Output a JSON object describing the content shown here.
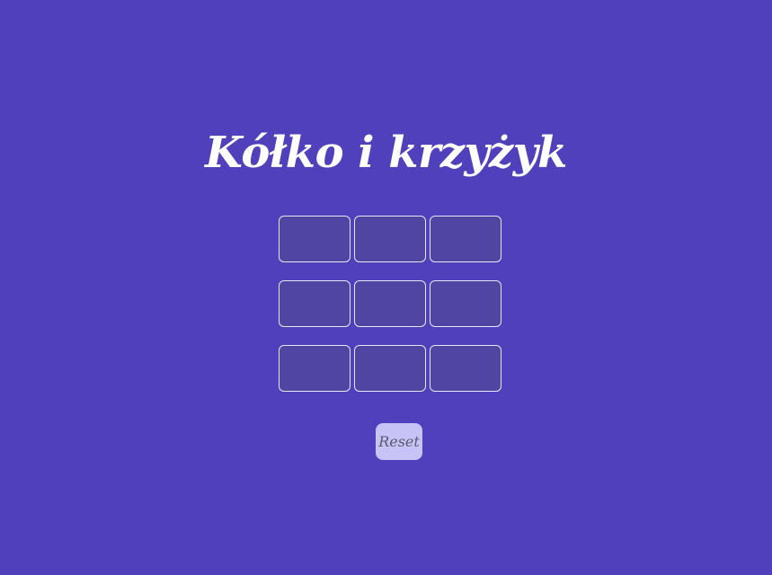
{
  "page": {
    "title": "Kółko i krzyżyk",
    "background_color": "#5040bc"
  },
  "board": {
    "rows": [
      [
        "",
        "",
        ""
      ],
      [
        "",
        "",
        ""
      ],
      [
        "",
        "",
        ""
      ]
    ]
  },
  "controls": {
    "reset_label": "Reset"
  }
}
